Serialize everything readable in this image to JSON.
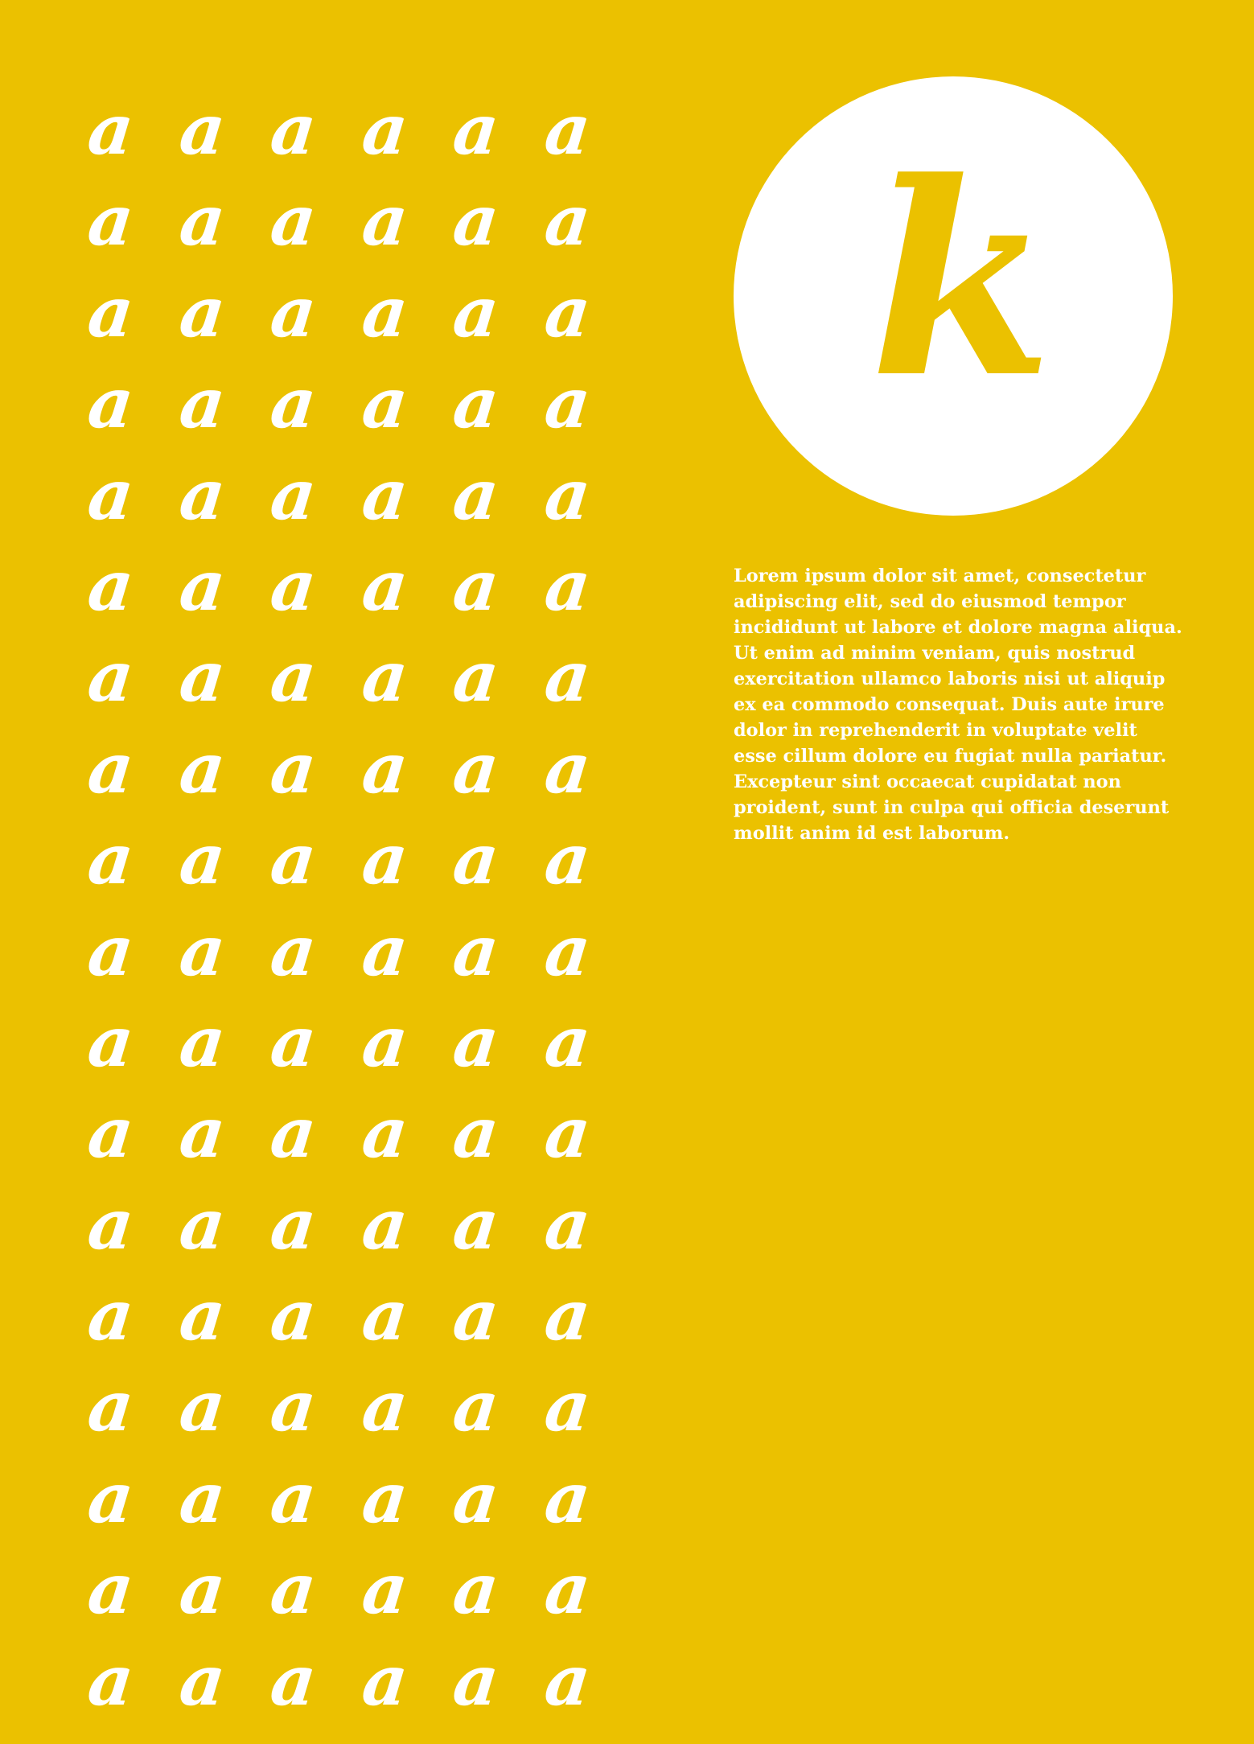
{
  "colors": {
    "background": "#ebc100",
    "glyph": "#ffffff",
    "circle": "#ffffff",
    "circle_letter": "#ebc100",
    "text": "#ffffff"
  },
  "pattern": {
    "glyph": "a",
    "rows": 18,
    "columns": 6
  },
  "circle": {
    "letter": "k"
  },
  "body_text": "Lorem ipsum dolor sit amet, consectetur adipiscing elit, sed do eiusmod tempor incididunt ut labore et dolore magna aliqua. Ut enim ad minim veniam, quis nostrud exercitation ullamco laboris nisi ut aliquip ex ea commodo consequat. Duis aute irure dolor in reprehenderit in voluptate velit esse cillum dolore eu fugiat nulla pariatur. Excepteur sint occaecat cupidatat non proident, sunt in culpa qui officia deserunt mollit anim id est laborum."
}
